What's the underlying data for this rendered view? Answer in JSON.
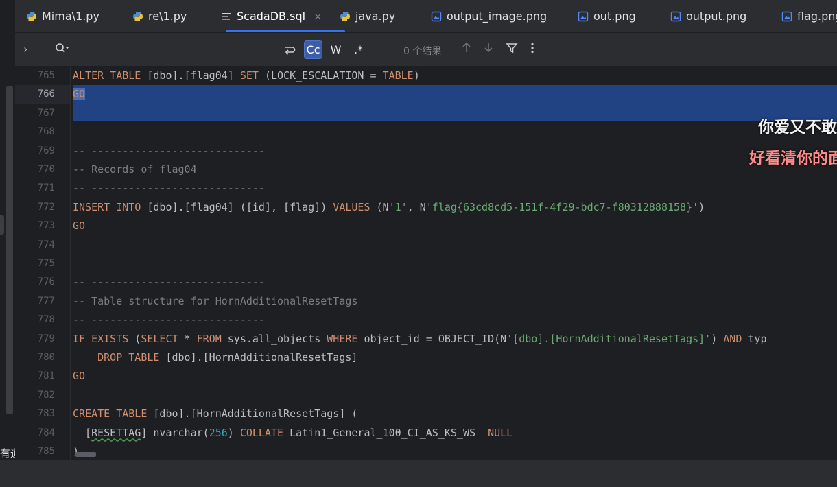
{
  "tabs": [
    {
      "label": "Mima\\1.py",
      "icon": "python-icon",
      "active": false
    },
    {
      "label": "re\\1.py",
      "icon": "python-icon",
      "active": false
    },
    {
      "label": "ScadaDB.sql",
      "icon": "text-file-icon",
      "active": true,
      "close": "×"
    },
    {
      "label": "java.py",
      "icon": "python-icon",
      "active": false
    },
    {
      "label": "output_image.png",
      "icon": "image-file-icon",
      "active": false
    },
    {
      "label": "out.png",
      "icon": "image-file-icon",
      "active": false
    },
    {
      "label": "output.png",
      "icon": "image-file-icon",
      "active": false
    },
    {
      "label": "flag.png",
      "icon": "image-file-icon",
      "active": false
    }
  ],
  "findbar": {
    "expand": "›",
    "match_case": "Cc",
    "words": "W",
    "regex": ".*",
    "results": "0 个结果"
  },
  "editor": {
    "lines": [
      {
        "n": "765",
        "html": "<span class='kw'>ALTER TABLE</span> [dbo].[flag04] <span class='kw'>SET</span> (LOCK_ESCALATION = <span class='kw'>TABLE</span>)"
      },
      {
        "n": "766",
        "html": "<span class='kw caret-go'>GO</span>",
        "current": true
      },
      {
        "n": "767",
        "html": ""
      },
      {
        "n": "768",
        "html": ""
      },
      {
        "n": "769",
        "html": "<span class='cmt'>-- ----------------------------</span>"
      },
      {
        "n": "770",
        "html": "<span class='cmt'>-- Records of flag04</span>"
      },
      {
        "n": "771",
        "html": "<span class='cmt'>-- ----------------------------</span>"
      },
      {
        "n": "772",
        "html": "<span class='kw'>INSERT INTO</span> [dbo].[flag04] ([id], [flag]) <span class='kw'>VALUES</span> (N<span class='str'>'1'</span>, N<span class='str'>'flag{63cd8cd5-151f-4f29-bdc7-f80312888158}'</span>)"
      },
      {
        "n": "773",
        "html": "<span class='kw'>GO</span>"
      },
      {
        "n": "774",
        "html": ""
      },
      {
        "n": "775",
        "html": ""
      },
      {
        "n": "776",
        "html": "<span class='cmt'>-- ----------------------------</span>"
      },
      {
        "n": "777",
        "html": "<span class='cmt'>-- Table structure for HornAdditionalResetTags</span>"
      },
      {
        "n": "778",
        "html": "<span class='cmt'>-- ----------------------------</span>"
      },
      {
        "n": "779",
        "html": "<span class='kw'>IF EXISTS</span> (<span class='kw'>SELECT</span> * <span class='kw'>FROM</span> sys.all_objects <span class='kw'>WHERE</span> object_id = OBJECT_ID(N<span class='str'>'[dbo].[HornAdditionalResetTags]'</span>) <span class='kw'>AND</span> typ"
      },
      {
        "n": "780",
        "html": "    <span class='kw'>DROP TABLE</span> [dbo].[HornAdditionalResetTags]"
      },
      {
        "n": "781",
        "html": "<span class='kw'>GO</span>"
      },
      {
        "n": "782",
        "html": ""
      },
      {
        "n": "783",
        "html": "<span class='kw'>CREATE TABLE</span> [dbo].[HornAdditionalResetTags] ("
      },
      {
        "n": "784",
        "html": "  [<span class='typo'>RESETTAG</span>] nvarchar(<span class='num'>256</span>) <span class='kw'>COLLATE</span> Latin1_General_100_CI_AS_KS_WS  <span class='kw'>NULL</span>"
      },
      {
        "n": "785",
        "html": ")"
      }
    ]
  },
  "subtitles": {
    "line1": "你爱又不敢",
    "line2": "好看清你的面"
  },
  "left_clip": "有道",
  "colors": {
    "accent": "#3574f0",
    "selection": "#214283",
    "keyword": "#cf8e6d",
    "string": "#6aab73"
  }
}
